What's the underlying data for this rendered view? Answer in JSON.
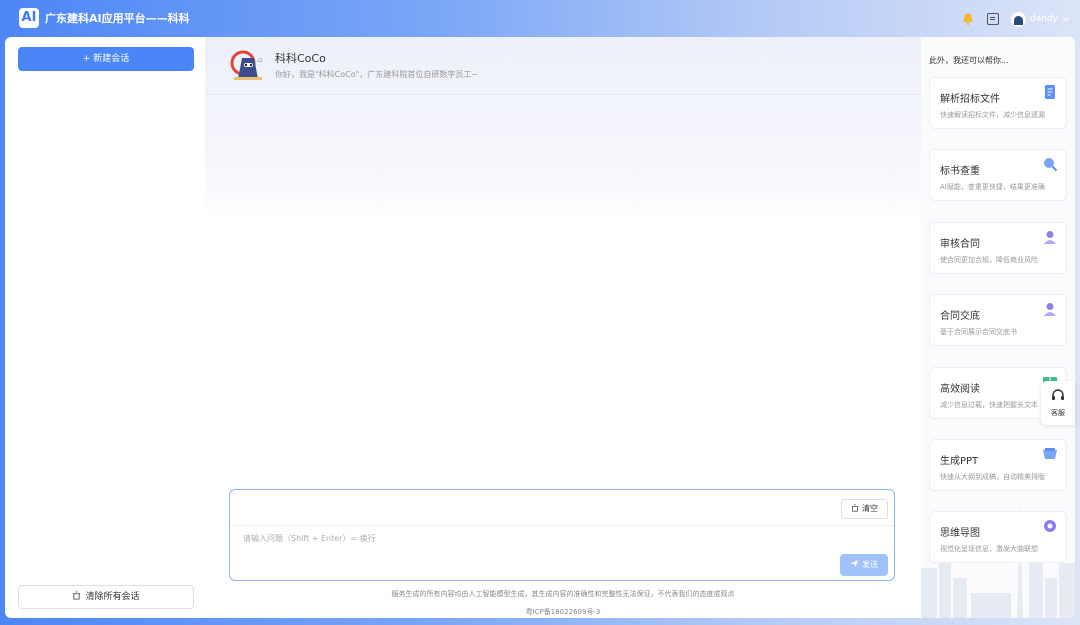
{
  "header": {
    "logo_text": "AI",
    "app_title": "广东建科AI应用平台——科科",
    "user_name": "dandy"
  },
  "sidebar": {
    "new_chat_label": "+ 新建会话",
    "clear_all_label": "清除所有会话"
  },
  "chat": {
    "bot_name": "科科CoCo",
    "greeting": "你好，我是\"科科CoCo\"，广东建科院首位自研数字员工~",
    "input_placeholder": "请输入问题（Shift + Enter）= 换行",
    "clear_label": "清空",
    "send_label": "发送",
    "disclaimer": "服务生成的所有内容均由人工智能模型生成，其生成内容的准确性和完整性无法保证，不代表我们的态度或观点",
    "icp": "粤ICP备18022609号-3"
  },
  "right_panel": {
    "title": "此外，我还可以帮你...",
    "cards": [
      {
        "title": "解析招标文件",
        "desc": "快速解读招标文件，减少信息遗漏",
        "icon": "document-icon",
        "color": "#5b8ff5"
      },
      {
        "title": "标书查重",
        "desc": "AI赋能，查重更快捷，结果更准确",
        "icon": "search-icon",
        "color": "#5b8ff5"
      },
      {
        "title": "审核合同",
        "desc": "使合同更加合规，降低商业风险",
        "icon": "user-icon",
        "color": "#8e7cf0"
      },
      {
        "title": "合同交底",
        "desc": "基于合同展示合同交底书",
        "icon": "user-icon",
        "color": "#8e7cf0"
      },
      {
        "title": "高效阅读",
        "desc": "减少信息过载，快速把握长文本",
        "icon": "book-icon",
        "color": "#3cc08a"
      },
      {
        "title": "生成PPT",
        "desc": "快速从大纲到成稿，自动精美排版",
        "icon": "ppt-icon",
        "color": "#5b8ff5"
      },
      {
        "title": "思维导图",
        "desc": "视觉化呈现信息，激发大脑联想",
        "icon": "mindmap-icon",
        "color": "#8e7cf0"
      }
    ]
  },
  "floating": {
    "service_label": "客服"
  },
  "colors": {
    "accent": "#4a86f7",
    "send_disabled": "#a0c2fa"
  }
}
